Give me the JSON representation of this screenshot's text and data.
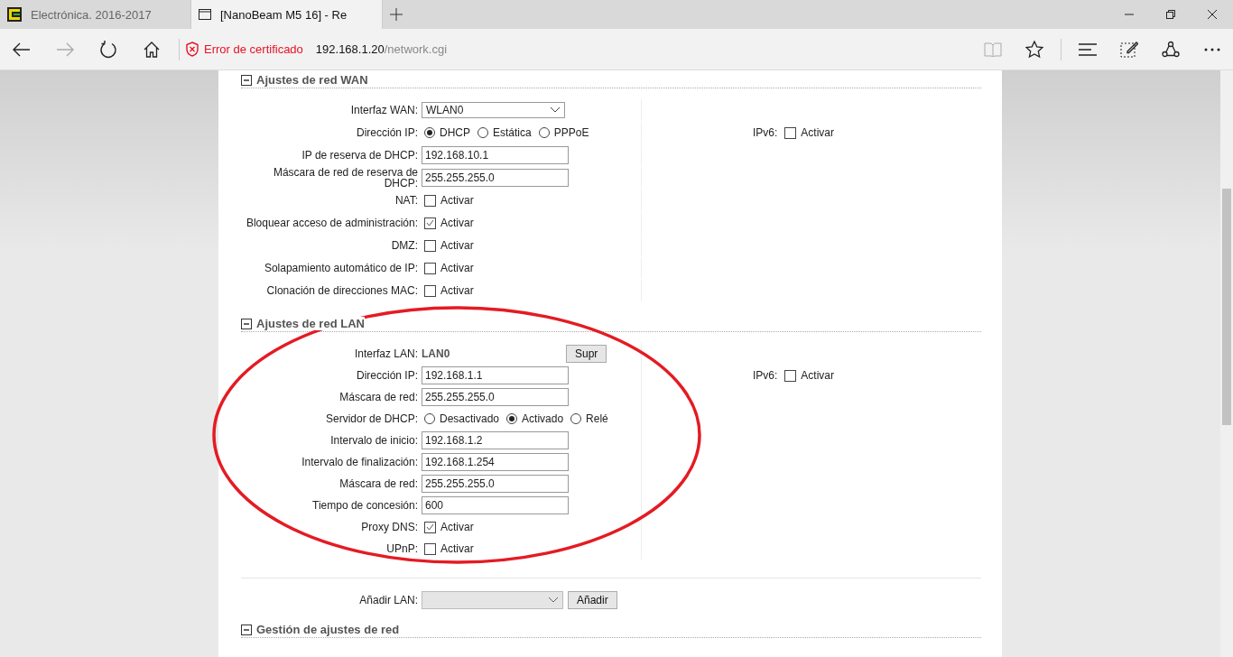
{
  "browser": {
    "tabs": [
      {
        "title": "Electrónica. 2016-2017",
        "selected": false
      },
      {
        "title": "[NanoBeam M5 16] - Re",
        "selected": true
      }
    ],
    "address": {
      "security_warning": "Error de certificado",
      "host": "192.168.1.20",
      "path": "/network.cgi"
    }
  },
  "sections": [
    {
      "title": "Ajustes de red WAN",
      "expanded": true,
      "rows": [
        {
          "kind": "select",
          "label": "Interfaz WAN:",
          "value": "WLAN0"
        },
        {
          "kind": "radio",
          "label": "Dirección IP:",
          "options": [
            {
              "label": "DHCP",
              "selected": true
            },
            {
              "label": "Estática",
              "selected": false
            },
            {
              "label": "PPPoE",
              "selected": false
            }
          ],
          "side": {
            "label": "IPv6:",
            "option": "Activar",
            "checked": false
          }
        },
        {
          "kind": "text",
          "label": "IP de reserva de DHCP:",
          "value": "192.168.10.1"
        },
        {
          "kind": "text",
          "label": "Máscara de red de reserva de DHCP:",
          "value": "255.255.255.0"
        },
        {
          "kind": "checkbox",
          "label": "NAT:",
          "option": "Activar",
          "checked": false
        },
        {
          "kind": "checkbox",
          "label": "Bloquear acceso de administración:",
          "option": "Activar",
          "checked": true
        },
        {
          "kind": "checkbox",
          "label": "DMZ:",
          "option": "Activar",
          "checked": false
        },
        {
          "kind": "checkbox",
          "label": "Solapamiento automático de IP:",
          "option": "Activar",
          "checked": false
        },
        {
          "kind": "checkbox",
          "label": "Clonación de direcciones MAC:",
          "option": "Activar",
          "checked": false
        }
      ]
    },
    {
      "title": "Ajustes de red LAN",
      "expanded": true,
      "highlighted": true,
      "rows": [
        {
          "kind": "static",
          "label": "Interfaz LAN:",
          "value": "LAN0",
          "button": "Supr"
        },
        {
          "kind": "text",
          "label": "Dirección IP:",
          "value": "192.168.1.1",
          "side": {
            "label": "IPv6:",
            "option": "Activar",
            "checked": false
          }
        },
        {
          "kind": "text",
          "label": "Máscara de red:",
          "value": "255.255.255.0"
        },
        {
          "kind": "radio",
          "label": "Servidor de DHCP:",
          "options": [
            {
              "label": "Desactivado",
              "selected": false
            },
            {
              "label": "Activado",
              "selected": true
            },
            {
              "label": "Relé",
              "selected": false
            }
          ]
        },
        {
          "kind": "text",
          "label": "Intervalo de inicio:",
          "value": "192.168.1.2"
        },
        {
          "kind": "text",
          "label": "Intervalo de finalización:",
          "value": "192.168.1.254"
        },
        {
          "kind": "text",
          "label": "Máscara de red:",
          "value": "255.255.255.0"
        },
        {
          "kind": "text",
          "label": "Tiempo de concesión:",
          "value": "600"
        },
        {
          "kind": "checkbox",
          "label": "Proxy DNS:",
          "option": "Activar",
          "checked": true
        },
        {
          "kind": "checkbox",
          "label": "UPnP:",
          "option": "Activar",
          "checked": false
        }
      ],
      "add_row": {
        "label": "Añadir LAN:",
        "disabled": true,
        "button": "Añadir"
      }
    },
    {
      "title": "Gestión de ajustes de red",
      "expanded": true
    }
  ]
}
